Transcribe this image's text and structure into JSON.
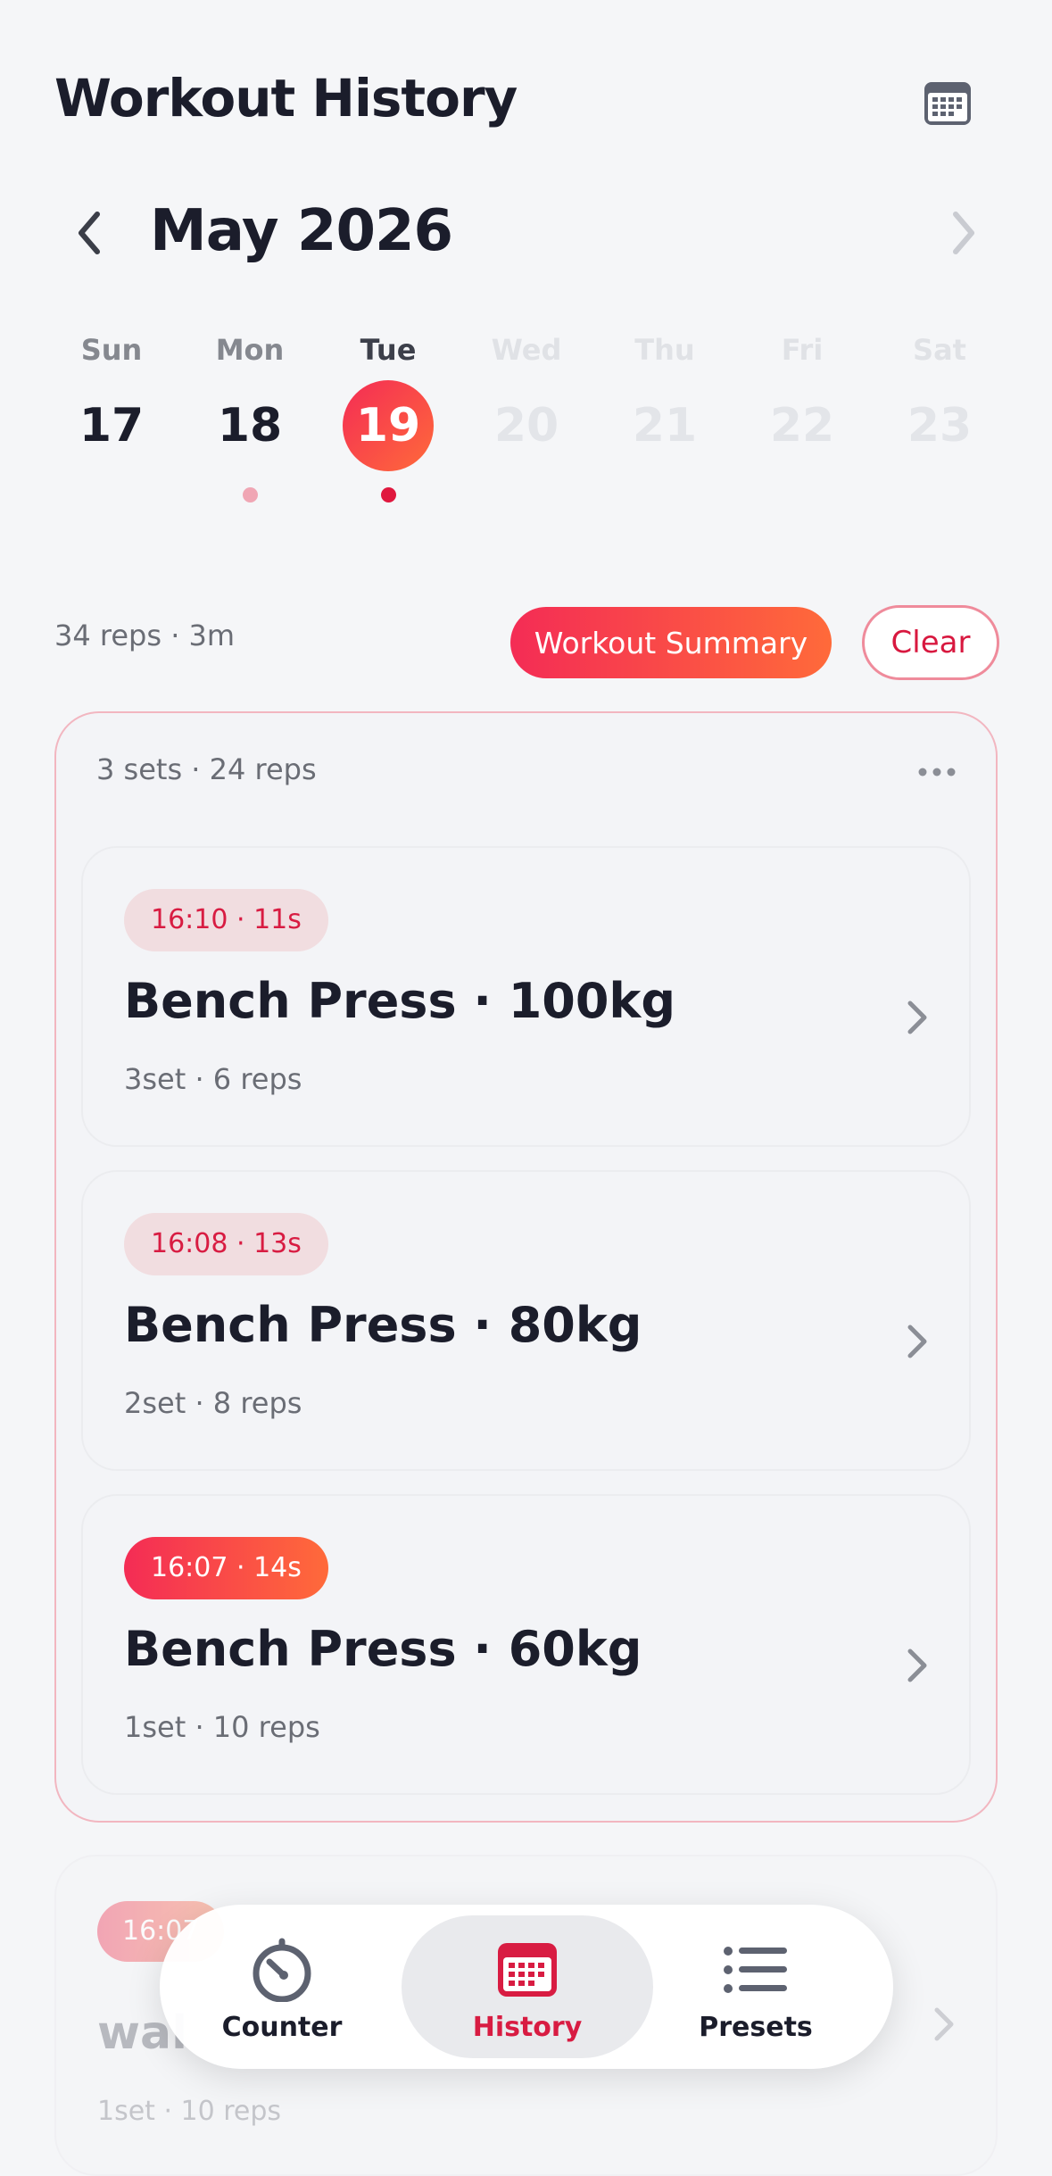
{
  "header": {
    "title": "Workout History"
  },
  "calendar": {
    "month_label": "May 2026",
    "days": [
      {
        "name": "Sun",
        "num": "17",
        "state": "past",
        "dot": ""
      },
      {
        "name": "Mon",
        "num": "18",
        "state": "past",
        "dot": "light"
      },
      {
        "name": "Tue",
        "num": "19",
        "state": "selected",
        "dot": "strong"
      },
      {
        "name": "Wed",
        "num": "20",
        "state": "future",
        "dot": ""
      },
      {
        "name": "Thu",
        "num": "21",
        "state": "future",
        "dot": ""
      },
      {
        "name": "Fri",
        "num": "22",
        "state": "future",
        "dot": ""
      },
      {
        "name": "Sat",
        "num": "23",
        "state": "future",
        "dot": ""
      }
    ]
  },
  "summary": {
    "day_totals": "34 reps · 3m",
    "summary_button": "Workout Summary",
    "clear_button": "Clear"
  },
  "group": {
    "meta": "3 sets · 24 reps",
    "sets": [
      {
        "time": "16:10 · 11s",
        "title": "Bench Press · 100kg",
        "sub": "3set · 6 reps",
        "badge": "soft"
      },
      {
        "time": "16:08 · 13s",
        "title": "Bench Press · 80kg",
        "sub": "2set · 8 reps",
        "badge": "soft"
      },
      {
        "time": "16:07 · 14s",
        "title": "Bench Press · 60kg",
        "sub": "1set · 10 reps",
        "badge": "strong"
      }
    ]
  },
  "next_card": {
    "time": "16:07",
    "title": "wal",
    "sub": "1set · 10 reps"
  },
  "tabs": [
    {
      "label": "Counter",
      "icon": "stopwatch-icon",
      "active": false
    },
    {
      "label": "History",
      "icon": "calendar-icon",
      "active": true
    },
    {
      "label": "Presets",
      "icon": "list-icon",
      "active": false
    }
  ],
  "colors": {
    "accent_start": "#f42c55",
    "accent_end": "#ff6a3a",
    "accent_text": "#d81c42",
    "card_border": "#f2b6c0"
  }
}
